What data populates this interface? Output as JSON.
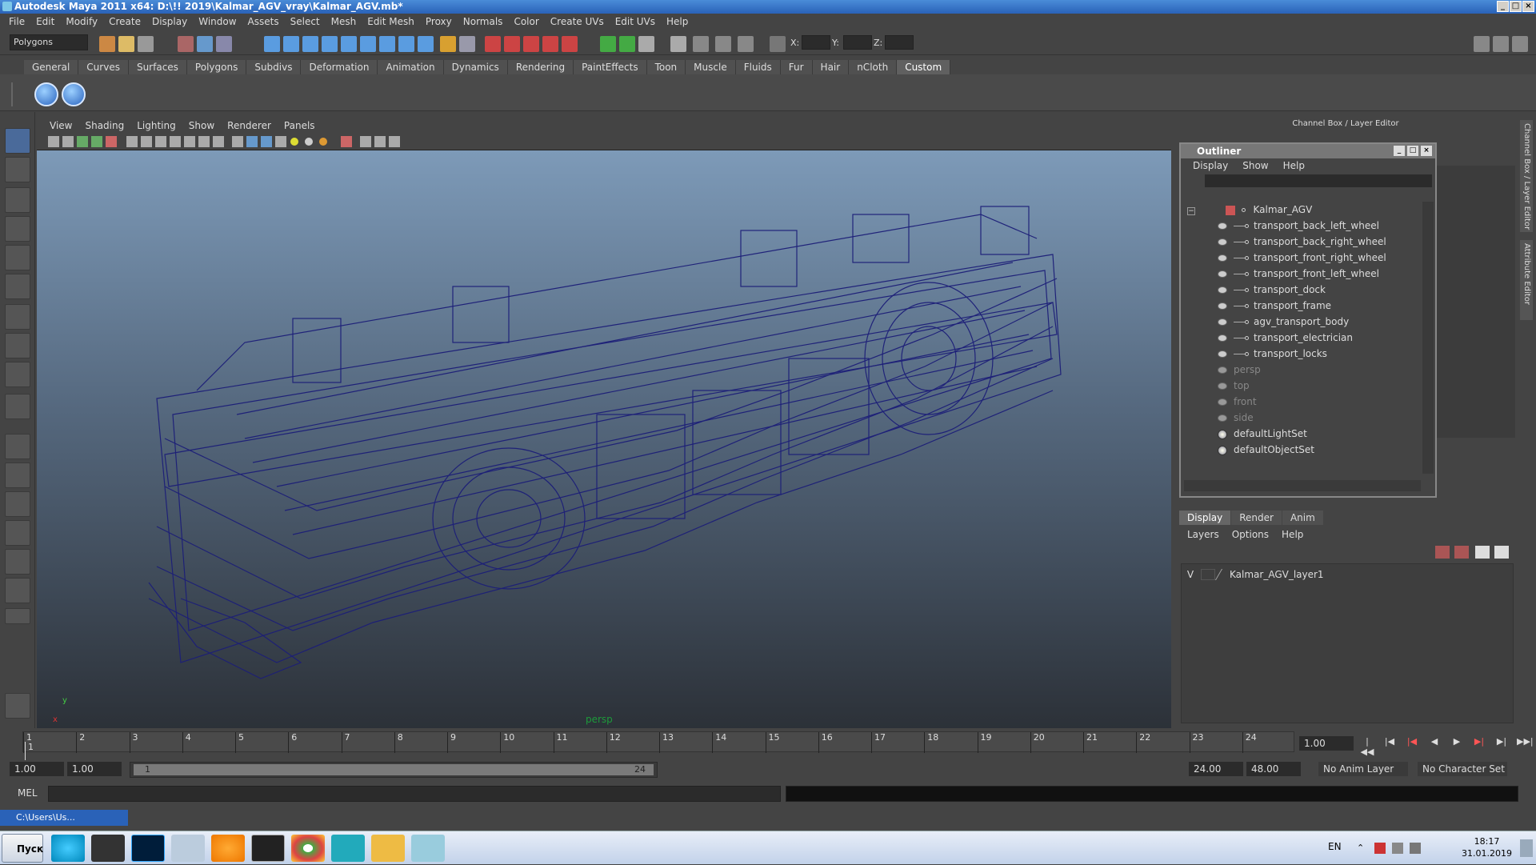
{
  "window": {
    "title": "Autodesk Maya 2011 x64: D:\\!! 2019\\Kalmar_AGV_vray\\Kalmar_AGV.mb*"
  },
  "menubar": [
    "File",
    "Edit",
    "Modify",
    "Create",
    "Display",
    "Window",
    "Assets",
    "Select",
    "Mesh",
    "Edit Mesh",
    "Proxy",
    "Normals",
    "Color",
    "Create UVs",
    "Edit UVs",
    "Help"
  ],
  "statusline": {
    "mode": "Polygons",
    "x_label": "X:",
    "y_label": "Y:",
    "z_label": "Z:"
  },
  "shelf": {
    "tabs": [
      "General",
      "Curves",
      "Surfaces",
      "Polygons",
      "Subdivs",
      "Deformation",
      "Animation",
      "Dynamics",
      "Rendering",
      "PaintEffects",
      "Toon",
      "Muscle",
      "Fluids",
      "Fur",
      "Hair",
      "nCloth",
      "Custom"
    ],
    "active_tab": "Custom"
  },
  "viewport": {
    "menus": [
      "View",
      "Shading",
      "Lighting",
      "Show",
      "Renderer",
      "Panels"
    ],
    "camera_label": "persp",
    "axis_x": "x",
    "axis_y": "y"
  },
  "channel_box": {
    "header": "Channel Box / Layer Editor"
  },
  "side_tabs": [
    "Channel Box / Layer Editor",
    "Attribute Editor"
  ],
  "outliner": {
    "title": "Outliner",
    "menus": [
      "Display",
      "Show",
      "Help"
    ],
    "root": "Kalmar_AGV",
    "children": [
      "transport_back_left_wheel",
      "transport_back_right_wheel",
      "transport_front_right_wheel",
      "transport_front_left_wheel",
      "transport_dock",
      "transport_frame",
      "agv_transport_body",
      "transport_electrician",
      "transport_locks"
    ],
    "cameras": [
      "persp",
      "top",
      "front",
      "side"
    ],
    "sets": [
      "defaultLightSet",
      "defaultObjectSet"
    ]
  },
  "layer_editor": {
    "tabs": [
      "Display",
      "Render",
      "Anim"
    ],
    "active_tab": "Display",
    "menus": [
      "Layers",
      "Options",
      "Help"
    ],
    "layer": {
      "visible": "V",
      "name": "Kalmar_AGV_layer1"
    }
  },
  "timeline": {
    "ticks": [
      "1",
      "2",
      "3",
      "4",
      "5",
      "6",
      "7",
      "8",
      "9",
      "10",
      "11",
      "12",
      "13",
      "14",
      "15",
      "16",
      "17",
      "18",
      "19",
      "20",
      "21",
      "22",
      "23",
      "24"
    ],
    "current_frame": "1.00",
    "playhead_label": "1"
  },
  "range": {
    "start": "1.00",
    "playback_start": "1.00",
    "slider_start": "1",
    "slider_end": "24",
    "playback_end": "24.00",
    "end": "48.00",
    "anim_layer": "No Anim Layer",
    "character_set": "No Character Set"
  },
  "command_line": {
    "label": "MEL"
  },
  "minimized_window": {
    "title": "C:\\Users\\Us..."
  },
  "taskbar": {
    "start_label": "Пуск",
    "language": "EN",
    "time": "18:17",
    "date": "31.01.2019"
  }
}
